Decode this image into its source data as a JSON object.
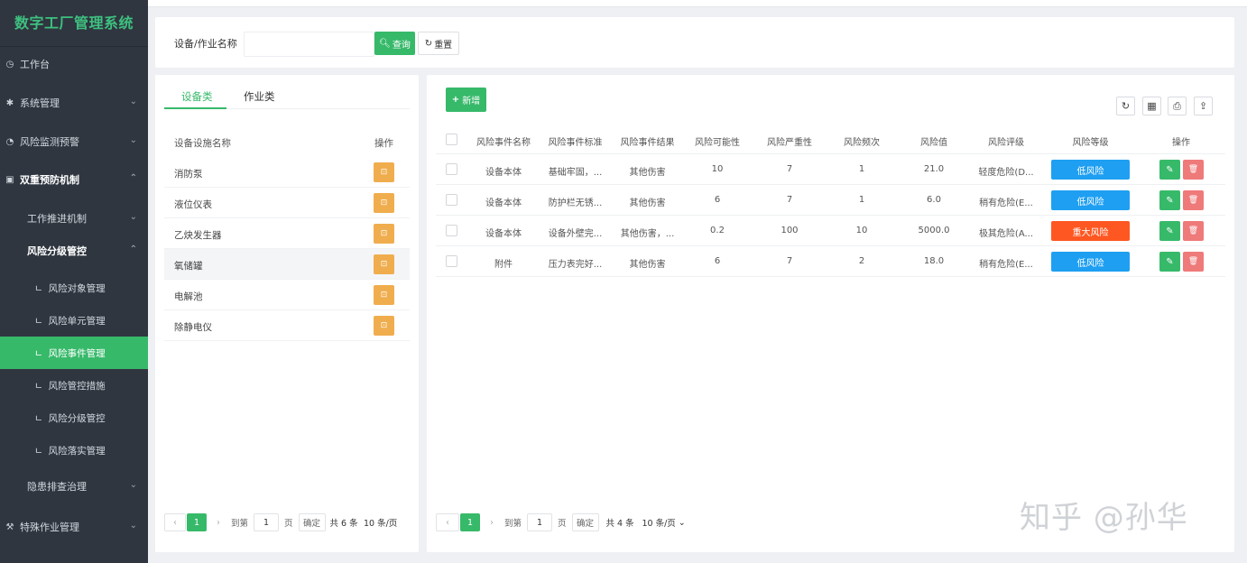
{
  "app_title": "数字工厂管理系统",
  "sidebar": {
    "items": [
      {
        "label": "工作台",
        "icon": "dashboard-icon",
        "level": 1
      },
      {
        "label": "系统管理",
        "icon": "gear-icon",
        "level": 1,
        "arrow": "down"
      },
      {
        "label": "风险监测预警",
        "icon": "alarm-icon",
        "level": 1,
        "arrow": "down"
      },
      {
        "label": "双重预防机制",
        "icon": "shield-icon",
        "level": 1,
        "arrow": "up"
      },
      {
        "label": "工作推进机制",
        "level": 2,
        "arrow": "down"
      },
      {
        "label": "风险分级管控",
        "level": 2,
        "arrow": "up"
      },
      {
        "label": "风险对象管理",
        "level": 3
      },
      {
        "label": "风险单元管理",
        "level": 3
      },
      {
        "label": "风险事件管理",
        "level": 3,
        "active": true
      },
      {
        "label": "风险管控措施",
        "level": 3
      },
      {
        "label": "风险分级管控",
        "level": 3
      },
      {
        "label": "风险落实管理",
        "level": 3
      },
      {
        "label": "隐患排查治理",
        "level": 2,
        "arrow": "down"
      },
      {
        "label": "特殊作业管理",
        "icon": "tools-icon",
        "level": 1,
        "arrow": "down"
      }
    ]
  },
  "search": {
    "label": "设备/作业名称",
    "input_value": "",
    "query_label": "查询",
    "reset_label": "重置"
  },
  "left_panel": {
    "tabs": [
      "设备类",
      "作业类"
    ],
    "active_tab": 0,
    "col_name": "设备设施名称",
    "col_op": "操作",
    "rows": [
      "消防泵",
      "液位仪表",
      "乙炔发生器",
      "氧储罐",
      "电解池",
      "除静电仪"
    ],
    "op_label": "⊡",
    "pager": {
      "page": "1",
      "goto_label": "到第",
      "goto_value": "1",
      "page_unit": "页",
      "confirm_label": "确定",
      "total": "共 6 条",
      "page_size": "10 条/页"
    }
  },
  "right_panel": {
    "add_label": "新增",
    "columns": [
      "风险事件名称",
      "风险事件标准",
      "风险事件结果",
      "风险可能性",
      "风险严重性",
      "风险频次",
      "风险值",
      "风险评级",
      "风险等级",
      "操作"
    ],
    "rows": [
      {
        "name": "设备本体",
        "standard": "基础牢固，...",
        "result": "其他伤害",
        "possibility": "10",
        "severity": "7",
        "frequency": "1",
        "value": "21.0",
        "rating": "轻度危险(D...",
        "level": "低风险",
        "level_color": "#1e9ff2"
      },
      {
        "name": "设备本体",
        "standard": "防护栏无锈...",
        "result": "其他伤害",
        "possibility": "6",
        "severity": "7",
        "frequency": "1",
        "value": "6.0",
        "rating": "稍有危险(E...",
        "level": "低风险",
        "level_color": "#1e9ff2"
      },
      {
        "name": "设备本体",
        "standard": "设备外壁完...",
        "result": "其他伤害，...",
        "possibility": "0.2",
        "severity": "100",
        "frequency": "10",
        "value": "5000.0",
        "rating": "极其危险(A...",
        "level": "重大风险",
        "level_color": "#ff5722"
      },
      {
        "name": "附件",
        "standard": "压力表完好...",
        "result": "其他伤害",
        "possibility": "6",
        "severity": "7",
        "frequency": "2",
        "value": "18.0",
        "rating": "稍有危险(E...",
        "level": "低风险",
        "level_color": "#1e9ff2"
      }
    ],
    "pager": {
      "page": "1",
      "goto_label": "到第",
      "goto_value": "1",
      "page_unit": "页",
      "confirm_label": "确定",
      "total": "共 4 条",
      "page_size": "10 条/页"
    }
  },
  "watermark": "知乎 @孙华"
}
